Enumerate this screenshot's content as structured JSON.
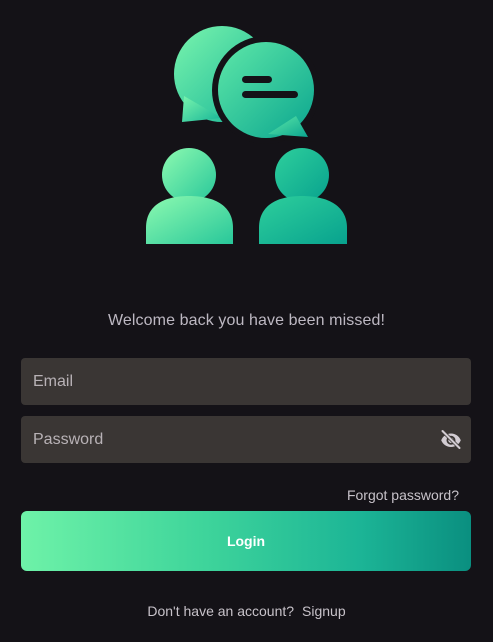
{
  "welcome_text": "Welcome back you have been missed!",
  "email": {
    "placeholder": "Email",
    "value": ""
  },
  "password": {
    "placeholder": "Password",
    "value": "",
    "toggle_icon": "visibility-off-icon"
  },
  "forgot_password": "Forgot password?",
  "login_label": "Login",
  "signup_prompt": "Don't have an account?",
  "signup_link": "Signup",
  "logo_icon": "group-chat-icon",
  "colors": {
    "background": "#141217",
    "field_background": "#3a3634",
    "gradient_start": "#6ef2a8",
    "gradient_end": "#0a8f80",
    "muted_text": "#bdb8c2"
  }
}
